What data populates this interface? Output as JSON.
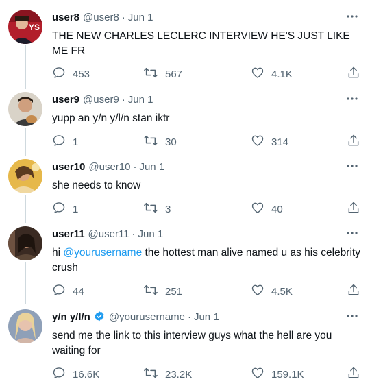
{
  "tweets": [
    {
      "name": "user8",
      "handle": "@user8",
      "date": "Jun 1",
      "verified": false,
      "text": "THE NEW CHARLES LECLERC INTERVIEW HE'S JUST LIKE ME FR",
      "replies": "453",
      "retweets": "567",
      "likes": "4.1K"
    },
    {
      "name": "user9",
      "handle": "@user9",
      "date": "Jun 1",
      "verified": false,
      "text": "yupp an y/n y/l/n stan iktr",
      "replies": "1",
      "retweets": "30",
      "likes": "314"
    },
    {
      "name": "user10",
      "handle": "@user10",
      "date": "Jun 1",
      "verified": false,
      "text": "she needs to know",
      "replies": "1",
      "retweets": "3",
      "likes": "40"
    },
    {
      "name": "user11",
      "handle": "@user11",
      "date": "Jun 1",
      "verified": false,
      "text_mention": "@yourusername",
      "text_rest": " the hottest man alive named u as his celebrity crush",
      "text_prefix": "hi ",
      "replies": "44",
      "retweets": "251",
      "likes": "4.5K"
    },
    {
      "name": "y/n y/l/n",
      "handle": "@yourusername",
      "date": "Jun 1",
      "verified": true,
      "text": "send me the link to this interview guys what the hell are you waiting for",
      "replies": "16.6K",
      "retweets": "23.2K",
      "likes": "159.1K"
    }
  ],
  "separator": "·",
  "colors": {
    "text": "#0f1419",
    "secondary": "#536471",
    "accent": "#1d9bf0",
    "thread_line": "#cfd9de"
  }
}
